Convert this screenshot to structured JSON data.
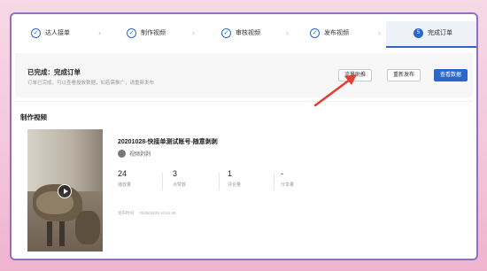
{
  "steps": [
    {
      "label": "达人接单",
      "icon": "check"
    },
    {
      "label": "制作视频",
      "icon": "check"
    },
    {
      "label": "审核视频",
      "icon": "check"
    },
    {
      "label": "发布视频",
      "icon": "check"
    },
    {
      "label": "完成订单",
      "icon": "5"
    }
  ],
  "status": {
    "title": "已完成：完成订单",
    "subtitle": "订单已完成，可以查看投放数据，如若需推广，请重新发布"
  },
  "actions": {
    "btn1": "流量助推",
    "btn2": "重新发布",
    "btn3": "查看数据"
  },
  "section": {
    "title": "制作视频"
  },
  "video": {
    "title": "20201028-快接单测试账号-随意剥剥",
    "author": "视频剥剥",
    "stats": [
      {
        "value": "24",
        "label": "播放量"
      },
      {
        "value": "3",
        "label": "点赞数"
      },
      {
        "value": "1",
        "label": "评论量"
      },
      {
        "value": "-",
        "label": "分享量"
      }
    ],
    "published_label": "发布时间:",
    "published_time": "2020/10/28 10:51:49"
  },
  "colors": {
    "accent": "#2b67c9",
    "arrow": "#e0412f"
  }
}
